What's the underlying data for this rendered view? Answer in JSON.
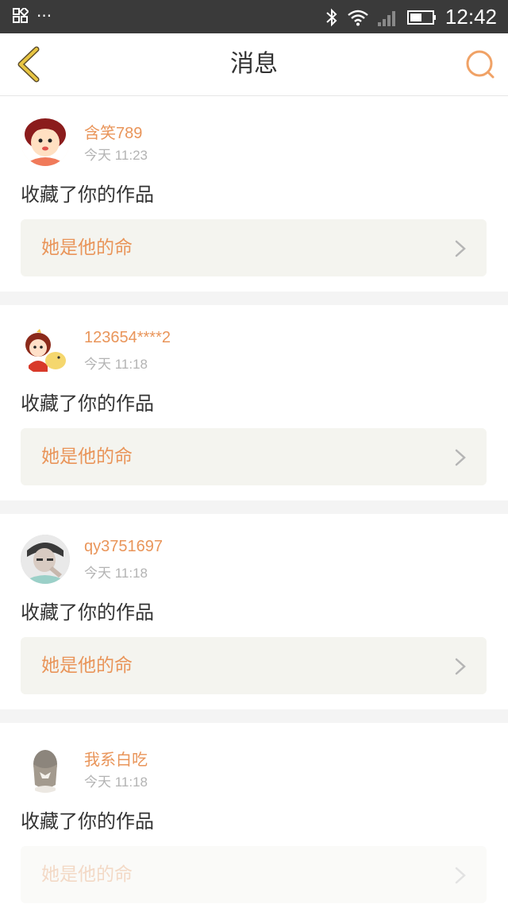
{
  "status_bar": {
    "time": "12:42",
    "dots": "···"
  },
  "header": {
    "title": "消息"
  },
  "colors": {
    "accent": "#e9955a",
    "back_icon": "#e8c542",
    "search_icon": "#f0a266"
  },
  "messages": [
    {
      "user": "含笑789",
      "time": "今天  11:23",
      "action": "收藏了你的作品",
      "work": "她是他的命",
      "avatar": "cartoon-girl-red-hair"
    },
    {
      "user": "123654****2",
      "time": "今天  11:18",
      "action": "收藏了你的作品",
      "work": "她是他的命",
      "avatar": "cartoon-girl-with-duck"
    },
    {
      "user": "qy3751697",
      "time": "今天  11:18",
      "action": "收藏了你的作品",
      "work": "她是他的命",
      "avatar": "boy-photo"
    },
    {
      "user": "我系白吃",
      "time": "今天  11:18",
      "action": "收藏了你的作品",
      "work": "她是他的命",
      "avatar": "girl-sketch-back"
    }
  ]
}
